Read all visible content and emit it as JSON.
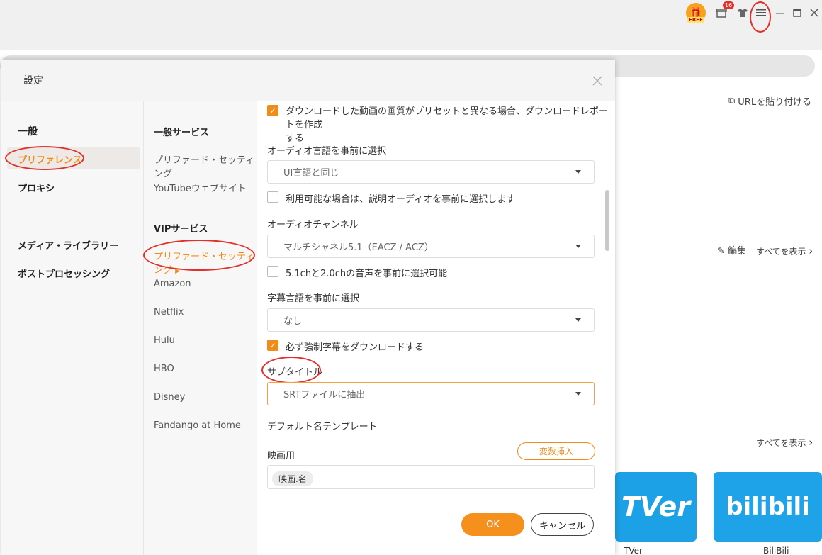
{
  "colors": {
    "accent": "#f08c1a",
    "highlight_circle": "#e0302a"
  },
  "topbar": {
    "free_badge": "FREE",
    "gift_count": "16",
    "icons": [
      "gift-icon",
      "shirt-icon",
      "menu-icon",
      "minimize-icon",
      "maximize-icon",
      "close-icon"
    ]
  },
  "background": {
    "paste_url": "URLを貼り付ける",
    "edit": "編集",
    "show_all_1": "すべてを表示",
    "show_all_2": "すべてを表示",
    "tiles": [
      {
        "logo": "TVer",
        "caption": "TVer"
      },
      {
        "logo": "bilibili",
        "caption": "BiliBili"
      }
    ]
  },
  "dialog": {
    "title": "設定",
    "nav_primary": {
      "group_general": "一般",
      "preferences": "プリファレンス",
      "proxy": "プロキシ",
      "media_library": "メディア・ライブラリー",
      "post_processing": "ポストプロセッシング"
    },
    "nav_secondary": {
      "general_services": "一般サービス",
      "preferred_settings_general": "プリファード・セッティング",
      "youtube_site": "YouTubeウェブサイト",
      "vip_services": "VIPサービス",
      "preferred_settings_vip": "プリファード・セッティング",
      "amazon": "Amazon",
      "netflix": "Netflix",
      "hulu": "Hulu",
      "hbo": "HBO",
      "disney": "Disney",
      "fandango": "Fandango at Home"
    },
    "content": {
      "report_checkbox_line1": "ダウンロードした動画の画質がプリセットと異なる場合、ダウンロードレポートを作成",
      "report_checkbox_line2": "する",
      "audio_lang_label": "オーディオ言語を事前に選択",
      "audio_lang_value": "UI言語と同じ",
      "audio_desc_checkbox": "利用可能な場合は、説明オーディオを事前に選択します",
      "audio_channel_label": "オーディオチャンネル",
      "audio_channel_value": "マルチシャネル5.1（EACZ / ACZ）",
      "channel_checkbox": "5.1chと2.0chの音声を事前に選択可能",
      "subtitle_lang_label": "字幕言語を事前に選択",
      "subtitle_lang_value": "なし",
      "forced_subs_checkbox": "必ず強制字幕をダウンロードする",
      "subtitle_label": "サブタイトル",
      "subtitle_value": "SRTファイルに抽出",
      "default_name_label": "デフォルト名テンプレート",
      "movie_label": "映画用",
      "insert_variable": "変数挿入",
      "movie_template_chip": "映画.名"
    },
    "footer": {
      "ok": "OK",
      "cancel": "キャンセル"
    }
  }
}
